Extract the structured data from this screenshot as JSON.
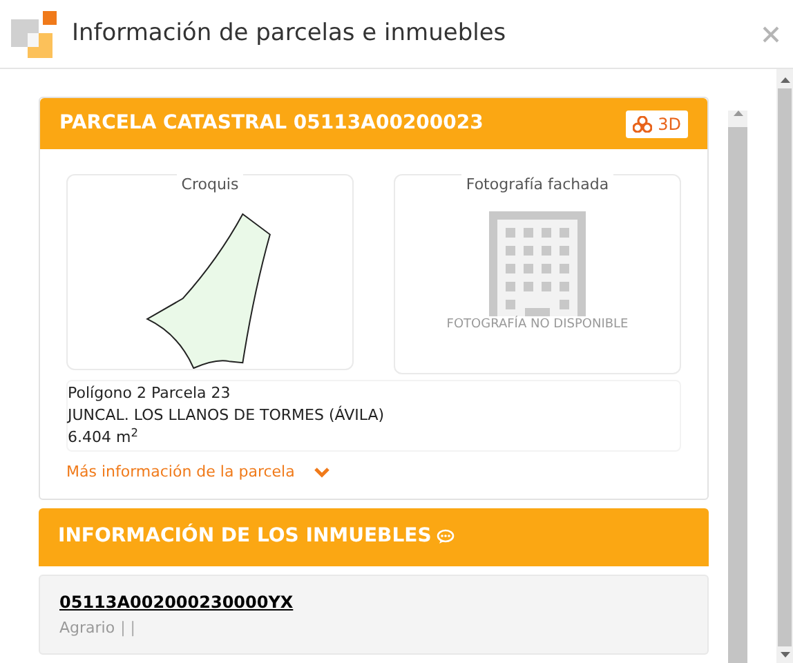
{
  "window": {
    "title": "Información de parcelas e inmuebles"
  },
  "parcel": {
    "title": "PARCELA CATASTRAL 05113A00200023",
    "button_3d": "3D",
    "sketch_label": "Croquis",
    "photo_label": "Fotografía fachada",
    "photo_unavailable": "FOTOGRAFÍA NO DISPONIBLE",
    "lines": [
      "Polígono 2 Parcela 23",
      "JUNCAL. LOS LLANOS DE TORMES (ÁVILA)",
      "6.404 m$^{2}$"
    ],
    "more_link": "Más información de la parcela",
    "expanded": false
  },
  "properties": {
    "title": "INFORMACIÓN DE LOS INMUEBLES",
    "items": [
      {
        "reference": "05113A002000230000YX",
        "use": "Agrario",
        "separators": "| |"
      }
    ]
  }
}
